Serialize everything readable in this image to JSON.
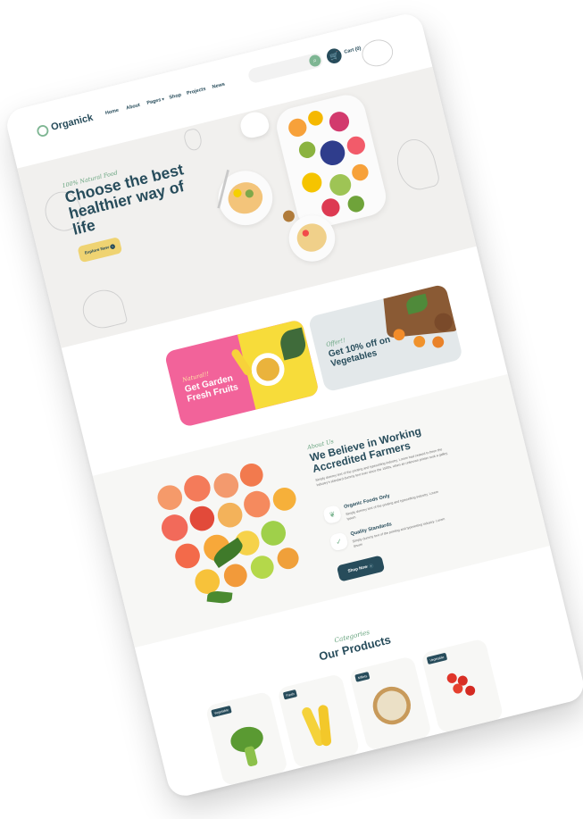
{
  "header": {
    "logo": "Organick",
    "nav": [
      "Home",
      "About",
      "Pages",
      "Shop",
      "Projects",
      "News"
    ],
    "cart_label": "Cart (0)"
  },
  "hero": {
    "tag": "100% Natural Food",
    "title": "Choose the best healthier way of life",
    "button": "Explore Now"
  },
  "offers": [
    {
      "tag": "Natural!!",
      "title": "Get Garden Fresh Fruits",
      "bg": "#f2639a",
      "tag_color": "#ffe7a5",
      "title_color": "#ffffff"
    },
    {
      "tag": "Offer!!",
      "title": "Get 10% off on Vegetables",
      "bg": "#e3e8ea",
      "tag_color": "#68a47f",
      "title_color": "#274c5b"
    }
  ],
  "about": {
    "tag": "About Us",
    "title": "We Believe in Working Accredited Farmers",
    "description": "Simply dummy text of the printing and typesetting industry. Lorem had ceased to been the industry's standard dummy text ever since the 1500s, when an unknown printer took a galley.",
    "features": [
      {
        "icon": "leaf-icon",
        "title": "Organic Foods Only",
        "desc": "Simply dummy text of the printing and typesetting industry. Lorem Ipsum"
      },
      {
        "icon": "badge-icon",
        "title": "Quality Standards",
        "desc": "Simply dummy text of the printing and typesetting industry. Lorem Ipsum"
      }
    ],
    "button": "Shop Now"
  },
  "products": {
    "tag": "Categories",
    "title": "Our Products",
    "items": [
      {
        "badge": "Vegetable"
      },
      {
        "badge": "Fresh"
      },
      {
        "badge": "Millets"
      },
      {
        "badge": "Vegetable"
      }
    ]
  },
  "colors": {
    "primary": "#274c5b",
    "accent": "#7eb693",
    "yellow": "#efd372",
    "pink": "#f2639a"
  }
}
